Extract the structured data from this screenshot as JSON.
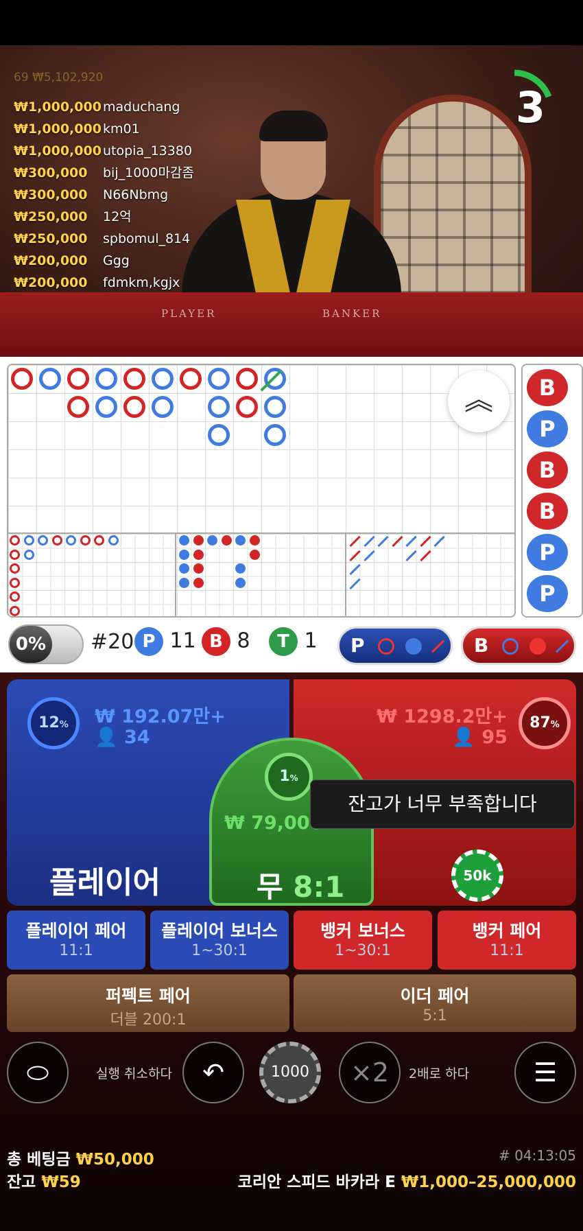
{
  "top_bets_header": "69 ₩5,102,920",
  "top_bets": [
    {
      "amount": "₩1,000,000",
      "name": "maduchang"
    },
    {
      "amount": "₩1,000,000",
      "name": "km01"
    },
    {
      "amount": "₩1,000,000",
      "name": "utopia_13380"
    },
    {
      "amount": "₩300,000",
      "name": "bij_1000마감좀"
    },
    {
      "amount": "₩300,000",
      "name": "N66Nbmg"
    },
    {
      "amount": "₩250,000",
      "name": "12억"
    },
    {
      "amount": "₩250,000",
      "name": "spbomul_814"
    },
    {
      "amount": "₩200,000",
      "name": "Ggg"
    },
    {
      "amount": "₩200,000",
      "name": "fdmkm,kgjx"
    }
  ],
  "countdown": "3",
  "felt": {
    "player": "PLAYER",
    "banker": "BANKER"
  },
  "side_column": [
    "B",
    "P",
    "B",
    "B",
    "P",
    "P"
  ],
  "stats": {
    "percent": "0%",
    "round": "#20",
    "player_label": "P",
    "player_count": "11",
    "banker_label": "B",
    "banker_count": "8",
    "tie_label": "T",
    "tie_count": "1"
  },
  "prediction": {
    "player": "P",
    "banker": "B"
  },
  "player_zone": {
    "percent": "12",
    "amount": "₩ 192.07만+",
    "users": "34",
    "label": "플레이어"
  },
  "banker_zone": {
    "percent": "87",
    "amount": "₩ 1298.2만+",
    "users": "95"
  },
  "tie_zone": {
    "percent": "1",
    "amount": "₩ 79,000",
    "label": "무",
    "odds": "8:1"
  },
  "tooltip": "잔고가 너무 부족합니다",
  "chip_on_banker": "50k",
  "side_bets": [
    {
      "label": "플레이어 페어",
      "odds": "11:1"
    },
    {
      "label": "플레이어 보너스",
      "odds": "1~30:1"
    },
    {
      "label": "뱅커 보너스",
      "odds": "1~30:1"
    },
    {
      "label": "뱅커 페어",
      "odds": "11:1"
    }
  ],
  "perfect_pair": {
    "label": "퍼펙트 페어",
    "odds": "더블 200:1"
  },
  "either_pair": {
    "label": "이더 페어",
    "odds": "5:1"
  },
  "controls": {
    "undo_label": "실행 취소하다",
    "selected_chip": "1000",
    "double_symbol": "×2",
    "double_label": "2배로 하다"
  },
  "footer": {
    "total_bet_label": "총 베팅금",
    "total_bet_value": "₩50,000",
    "balance_label": "잔고",
    "balance_value": "₩59",
    "round_id": "# 04:13:05",
    "table_name": "코리안 스피드 바카라 E",
    "limits": "₩1,000–25,000,000"
  },
  "colors": {
    "player": "#2b4bb6",
    "banker": "#d0282a",
    "tie": "#3f9e3c",
    "gold": "#ffd24a"
  }
}
